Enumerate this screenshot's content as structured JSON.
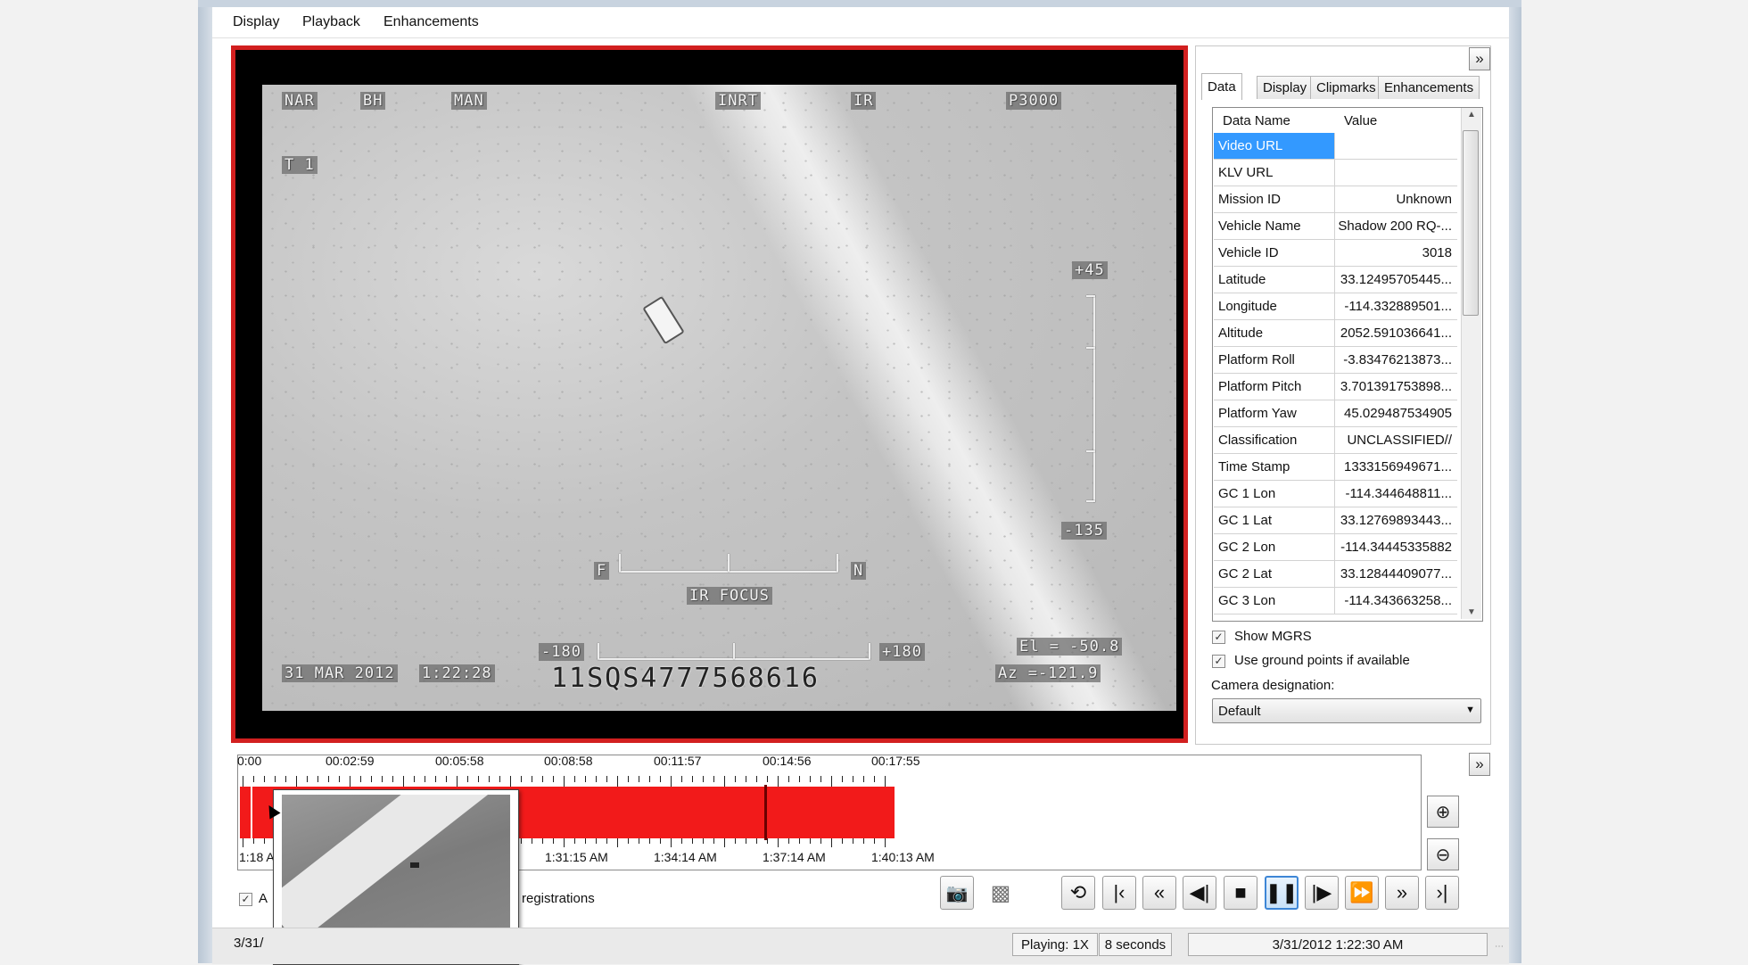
{
  "menu": [
    "Display",
    "Playback",
    "Enhancements"
  ],
  "video_osd": {
    "top_labels": [
      "NAR",
      "BH",
      "MAN",
      "INRT",
      "IR",
      "P3000"
    ],
    "track_label": "T 1",
    "elev_top": "+45",
    "elev_bottom": "-135",
    "focus_left": "F",
    "focus_right": "N",
    "focus_label": "IR FOCUS",
    "az_left": "-180",
    "az_right": "+180",
    "date": "31 MAR 2012",
    "time": "1:22:28",
    "mgrs": "11SQS4777568616",
    "elevation": "El = -50.8",
    "azimuth": "Az =-121.9"
  },
  "panel": {
    "tabs": [
      "Data",
      "Display",
      "Clipmarks",
      "Enhancements"
    ],
    "active_tab": "Data",
    "columns": [
      "Data Name",
      "Value"
    ],
    "rows": [
      {
        "name": "Video URL",
        "value": ""
      },
      {
        "name": "KLV URL",
        "value": ""
      },
      {
        "name": "Mission ID",
        "value": "Unknown"
      },
      {
        "name": "Vehicle Name",
        "value": "Shadow 200 RQ-..."
      },
      {
        "name": "Vehicle ID",
        "value": "3018"
      },
      {
        "name": "Latitude",
        "value": "33.12495705445..."
      },
      {
        "name": "Longitude",
        "value": "-114.332889501..."
      },
      {
        "name": "Altitude",
        "value": "2052.591036641..."
      },
      {
        "name": "Platform Roll",
        "value": "-3.83476213873..."
      },
      {
        "name": "Platform Pitch",
        "value": "3.701391753898..."
      },
      {
        "name": "Platform Yaw",
        "value": "45.029487534905"
      },
      {
        "name": "Classification",
        "value": "UNCLASSIFIED//"
      },
      {
        "name": "Time Stamp",
        "value": "1333156949671..."
      },
      {
        "name": "GC 1 Lon",
        "value": "-114.344648811..."
      },
      {
        "name": "GC 1 Lat",
        "value": "33.12769893443..."
      },
      {
        "name": "GC 2 Lon",
        "value": "-114.34445335882"
      },
      {
        "name": "GC 2 Lat",
        "value": "33.12844409077..."
      },
      {
        "name": "GC 3 Lon",
        "value": "-114.343663258..."
      }
    ],
    "show_mgrs_label": "Show MGRS",
    "show_mgrs_checked": true,
    "use_ground_label": "Use ground points if available",
    "use_ground_checked": true,
    "camera_label": "Camera designation:",
    "camera_value": "Default"
  },
  "timeline": {
    "top_ticks": [
      "0:00",
      "00:02:59",
      "00:05:58",
      "00:08:58",
      "00:11:57",
      "00:14:56",
      "00:17:55"
    ],
    "bottom_ticks": [
      "1:18 A",
      "1:31:15 AM",
      "1:34:14 AM",
      "1:37:14 AM",
      "1:40:13 AM"
    ],
    "checkbox_label_partial": "A",
    "registrations_label": "registrations"
  },
  "status": {
    "left": "3/31/",
    "playing": "Playing: 1X",
    "interval": "8 seconds",
    "datetime": "3/31/2012 1:22:30 AM"
  },
  "colors": {
    "video_border": "#d21f1f",
    "timeline_bar": "#f21a1a",
    "selection": "#3399ff"
  }
}
